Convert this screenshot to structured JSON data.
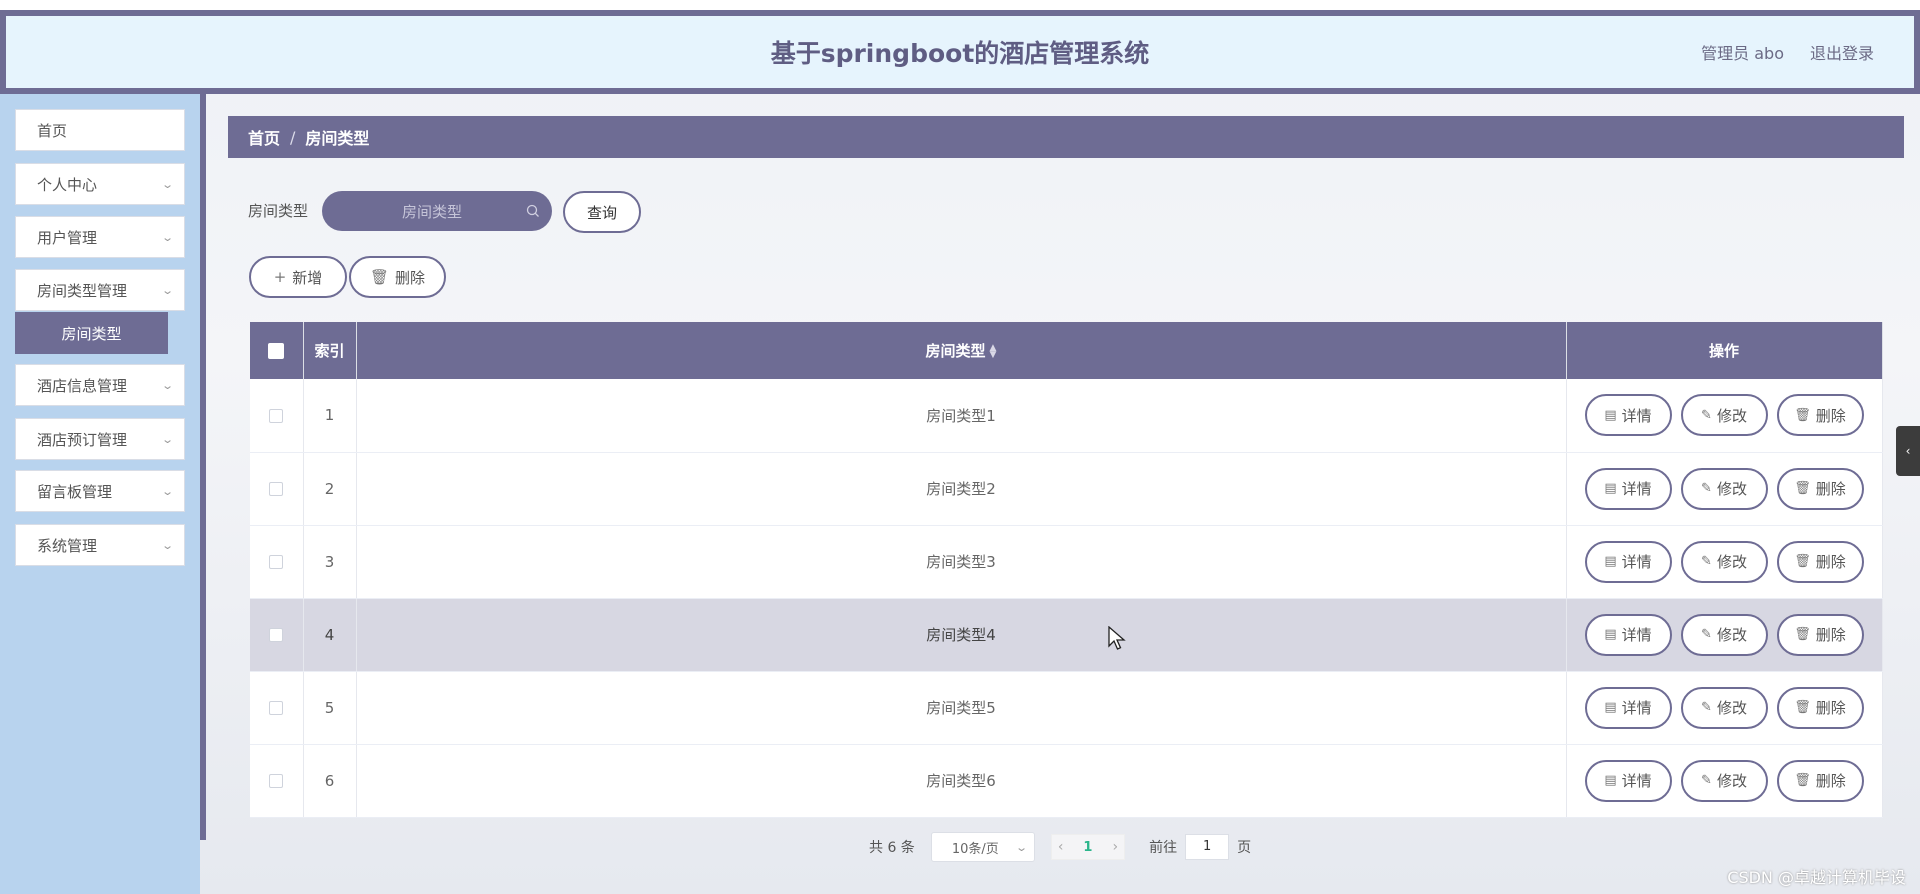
{
  "header": {
    "title": "基于springboot的酒店管理系统",
    "user": "管理员 abo",
    "logout": "退出登录"
  },
  "sidebar": {
    "items": [
      {
        "label": "首页"
      },
      {
        "label": "个人中心"
      },
      {
        "label": "用户管理"
      },
      {
        "label": "房间类型管理"
      },
      {
        "label": "酒店信息管理"
      },
      {
        "label": "酒店预订管理"
      },
      {
        "label": "留言板管理"
      },
      {
        "label": "系统管理"
      }
    ],
    "submenu_active": "房间类型"
  },
  "breadcrumb": {
    "home": "首页",
    "sep": "/",
    "current": "房间类型"
  },
  "search": {
    "label": "房间类型",
    "placeholder": "房间类型",
    "query_button": "查询"
  },
  "toolbar": {
    "add_label": "新增",
    "delete_label": "删除"
  },
  "table": {
    "columns": {
      "index": "索引",
      "type": "房间类型",
      "ops": "操作"
    },
    "rows": [
      {
        "index": "1",
        "type": "房间类型1"
      },
      {
        "index": "2",
        "type": "房间类型2"
      },
      {
        "index": "3",
        "type": "房间类型3"
      },
      {
        "index": "4",
        "type": "房间类型4"
      },
      {
        "index": "5",
        "type": "房间类型5"
      },
      {
        "index": "6",
        "type": "房间类型6"
      }
    ],
    "actions": {
      "detail": "详情",
      "edit": "修改",
      "delete": "删除"
    }
  },
  "pagination": {
    "total": "共 6 条",
    "page_size": "10条/页",
    "current_page": "1",
    "goto_prefix": "前往",
    "goto_value": "1",
    "goto_suffix": "页"
  },
  "watermark": "CSDN @卓越计算机毕设",
  "colors": {
    "accent": "#6e6c94",
    "sidebar": "#b8d3ee",
    "header_bg": "#e6f4fd"
  }
}
